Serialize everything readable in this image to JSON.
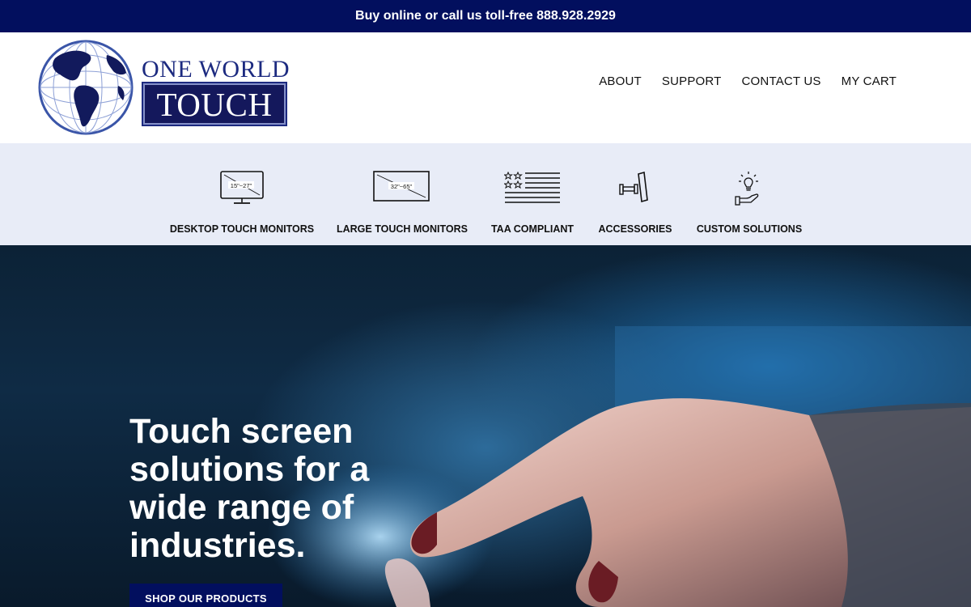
{
  "topbar": {
    "message": "Buy online or call us toll-free 888.928.2929"
  },
  "header": {
    "logo": {
      "line1": "ONE WORLD",
      "line2": "TOUCH"
    },
    "nav": [
      {
        "label": "ABOUT"
      },
      {
        "label": "SUPPORT"
      },
      {
        "label": "CONTACT US"
      },
      {
        "label": "MY CART"
      }
    ]
  },
  "categories": [
    {
      "label": "DESKTOP TOUCH MONITORS",
      "icon": "desktop-monitor-icon",
      "size_text": "15\"~27\""
    },
    {
      "label": "LARGE TOUCH MONITORS",
      "icon": "large-monitor-icon",
      "size_text": "32\"~65\""
    },
    {
      "label": "TAA COMPLIANT",
      "icon": "flag-icon"
    },
    {
      "label": "ACCESSORIES",
      "icon": "wall-mount-icon"
    },
    {
      "label": "CUSTOM SOLUTIONS",
      "icon": "lightbulb-hand-icon"
    }
  ],
  "hero": {
    "title": "Touch screen solutions for a wide range of industries.",
    "button": "SHOP OUR PRODUCTS"
  },
  "colors": {
    "brand_navy": "#020f5e",
    "category_bar": "#e8ecf7"
  }
}
